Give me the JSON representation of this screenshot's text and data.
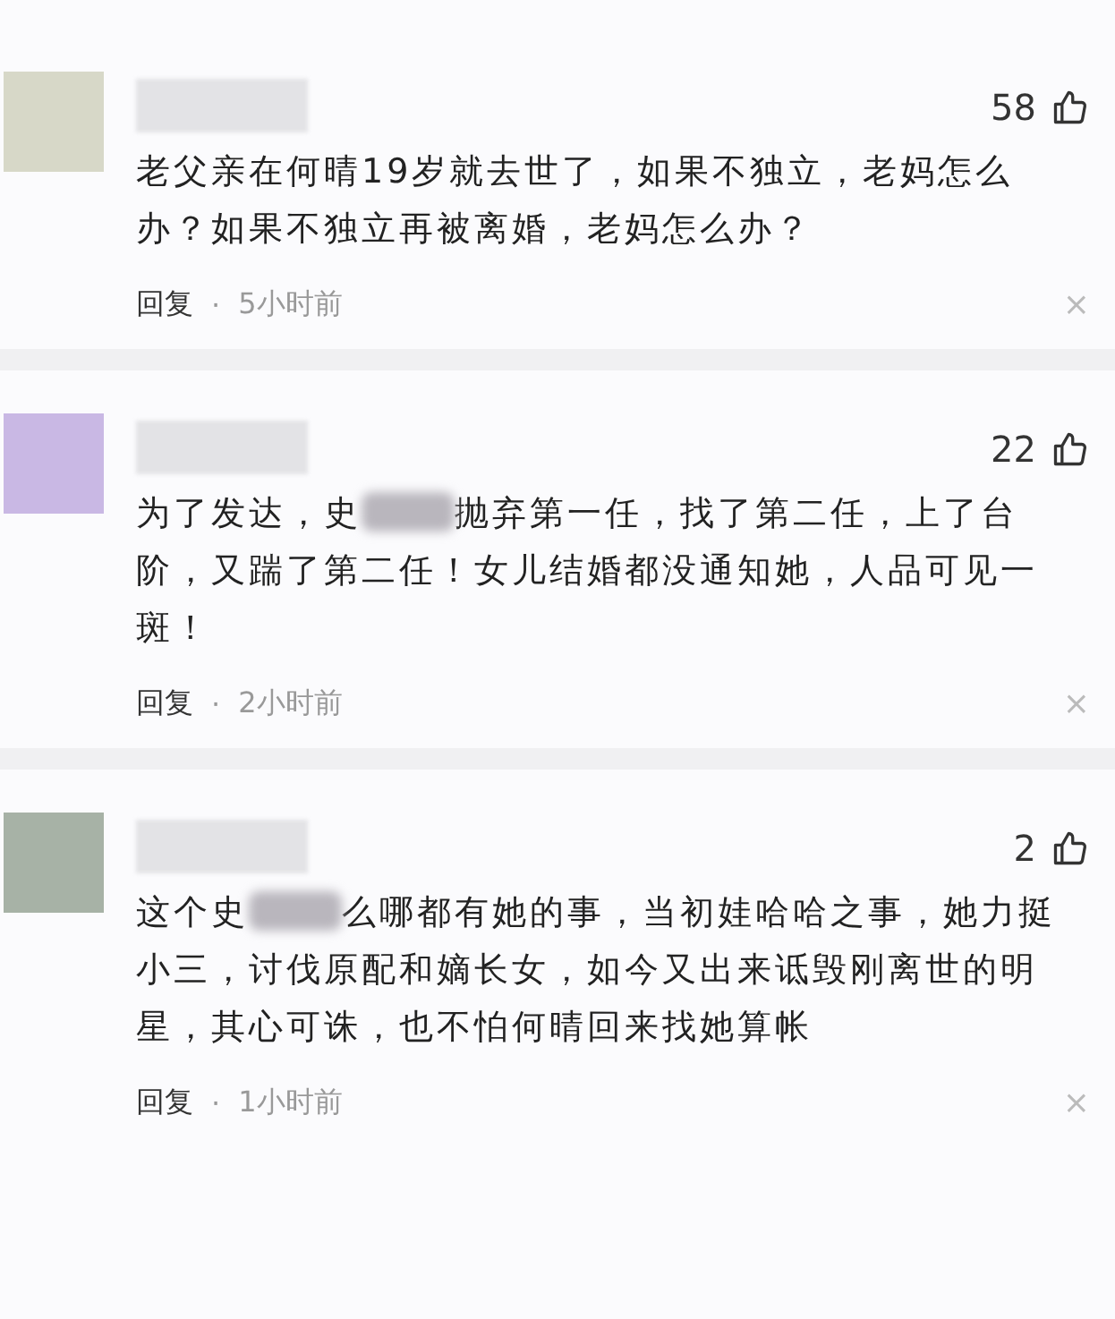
{
  "comments": [
    {
      "color": "#d7d8c8",
      "likes": "58",
      "text_parts": [
        "老父亲在何晴19岁就去世了，如果不独立，老妈怎么办？如果不独立再被离婚，老妈怎么办？"
      ],
      "reply": "回复",
      "separator": "·",
      "time": "5小时前",
      "close": "×"
    },
    {
      "color": "#c9b8e4",
      "likes": "22",
      "text_parts": [
        "为了发达，史",
        "抛弃第一任，找了第二任，上了台阶，又踹了第二任！女儿结婚都没通知她，人品可见一斑！"
      ],
      "reply": "回复",
      "separator": "·",
      "time": "2小时前",
      "close": "×"
    },
    {
      "color": "#a7b2a6",
      "likes": "2",
      "text_parts": [
        "这个史",
        "么哪都有她的事，当初娃哈哈之事，她力挺小三，讨伐原配和嫡长女，如今又出来诋毁刚离世的明星，其心可诛，也不怕何晴回来找她算帐"
      ],
      "reply": "回复",
      "separator": "·",
      "time": "1小时前",
      "close": "×"
    }
  ]
}
